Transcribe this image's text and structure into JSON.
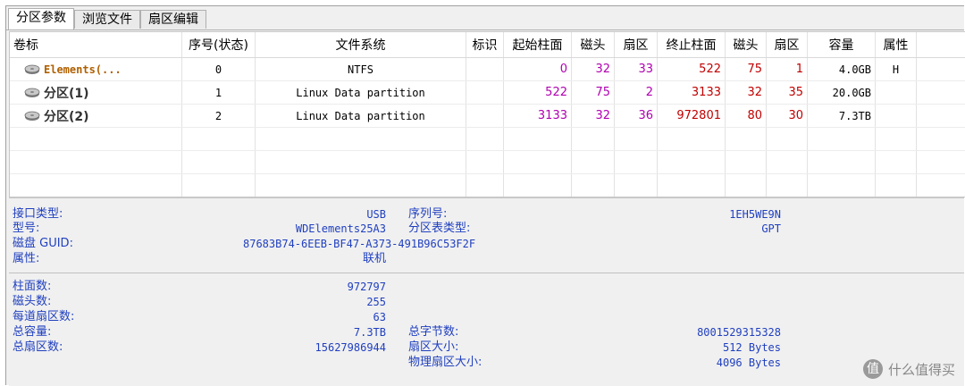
{
  "tabs": [
    {
      "label": "分区参数",
      "active": true
    },
    {
      "label": "浏览文件",
      "active": false
    },
    {
      "label": "扇区编辑",
      "active": false
    }
  ],
  "table": {
    "columns": [
      "卷标",
      "序号(状态)",
      "文件系统",
      "标识",
      "起始柱面",
      "磁头",
      "扇区",
      "终止柱面",
      "磁头",
      "扇区",
      "容量",
      "属性"
    ],
    "rows": [
      {
        "icon": "disk-icon",
        "label": "Elements(...",
        "index": "0",
        "fs": "NTFS",
        "flag": "",
        "start_cyl": "0",
        "start_head": "32",
        "start_sector": "33",
        "end_cyl": "522",
        "end_head": "75",
        "end_sector": "1",
        "capacity": "4.0GB",
        "attr": "H"
      },
      {
        "icon": "disk-icon",
        "label": "分区(1)",
        "index": "1",
        "fs": "Linux Data partition",
        "flag": "",
        "start_cyl": "522",
        "start_head": "75",
        "start_sector": "2",
        "end_cyl": "3133",
        "end_head": "32",
        "end_sector": "35",
        "capacity": "20.0GB",
        "attr": ""
      },
      {
        "icon": "disk-icon",
        "label": "分区(2)",
        "index": "2",
        "fs": "Linux Data partition",
        "flag": "",
        "start_cyl": "3133",
        "start_head": "32",
        "start_sector": "36",
        "end_cyl": "972801",
        "end_head": "80",
        "end_sector": "30",
        "capacity": "7.3TB",
        "attr": ""
      }
    ]
  },
  "info": {
    "interface_label": "接口类型:",
    "interface_value": "USB",
    "model_label": "型号:",
    "model_value": "WDElements25A3",
    "guid_label": "磁盘 GUID:",
    "guid_value": "87683B74-6EEB-BF47-A373-491B96C53F2F",
    "attr_label": "属性:",
    "attr_value": "联机",
    "serial_label": "序列号:",
    "serial_value": "1EH5WE9N",
    "ptype_label": "分区表类型:",
    "ptype_value": "GPT",
    "cyl_label": "柱面数:",
    "cyl_value": "972797",
    "heads_label": "磁头数:",
    "heads_value": "255",
    "spt_label": "每道扇区数:",
    "spt_value": "63",
    "cap_label": "总容量:",
    "cap_value": "7.3TB",
    "sectors_label": "总扇区数:",
    "sectors_value": "15627986944",
    "bytes_label": "总字节数:",
    "bytes_value": "8001529315328",
    "ssize_label": "扇区大小:",
    "ssize_value": "512 Bytes",
    "psize_label": "物理扇区大小:",
    "psize_value": "4096 Bytes"
  },
  "watermark": {
    "icon": "value-icon",
    "glyph": "值",
    "text": "什么值得买"
  }
}
